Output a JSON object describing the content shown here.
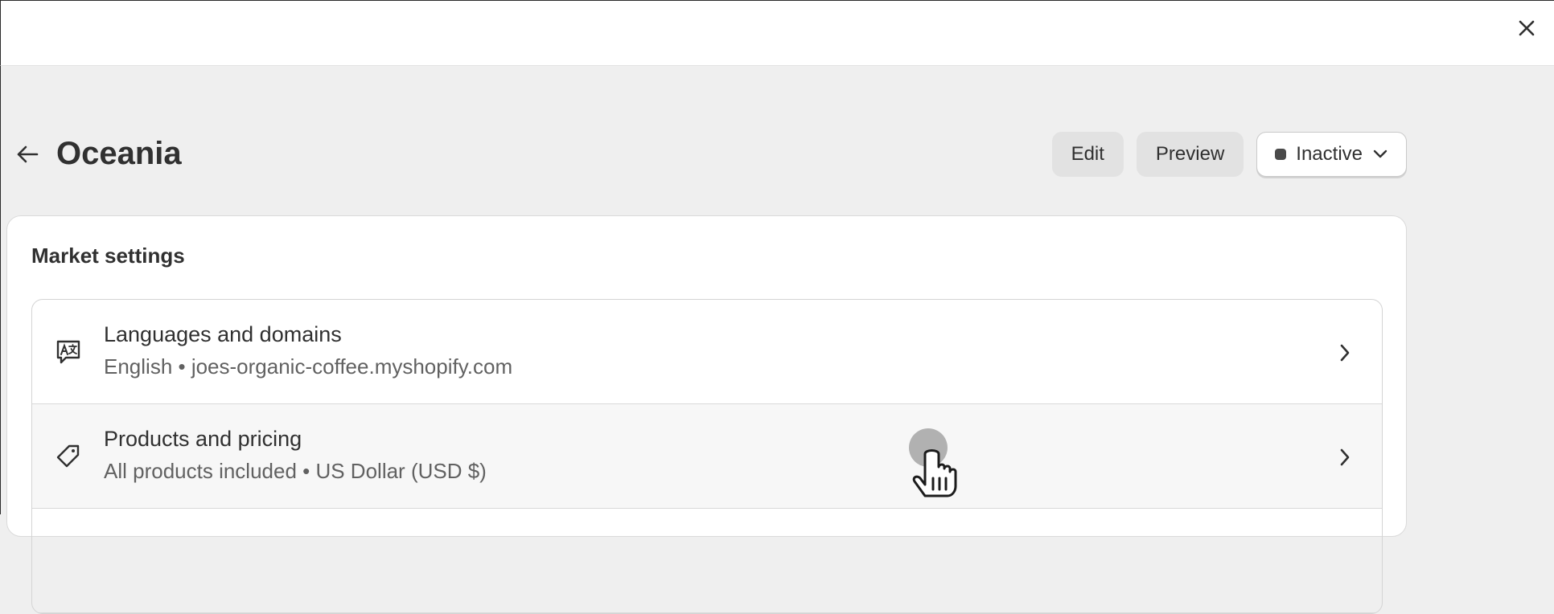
{
  "header": {
    "title": "Oceania",
    "edit_label": "Edit",
    "preview_label": "Preview",
    "status_label": "Inactive"
  },
  "card": {
    "title": "Market settings",
    "rows": [
      {
        "title": "Languages and domains",
        "subtitle": "English • joes-organic-coffee.myshopify.com",
        "icon": "translate-icon"
      },
      {
        "title": "Products and pricing",
        "subtitle": "All products included • US Dollar (USD $)",
        "icon": "price-tag-icon"
      }
    ]
  },
  "colors": {
    "page_bg": "#efefef",
    "card_bg": "#ffffff",
    "text": "#303030",
    "subtext": "#616161",
    "status_dot": "#4a4a4a"
  }
}
